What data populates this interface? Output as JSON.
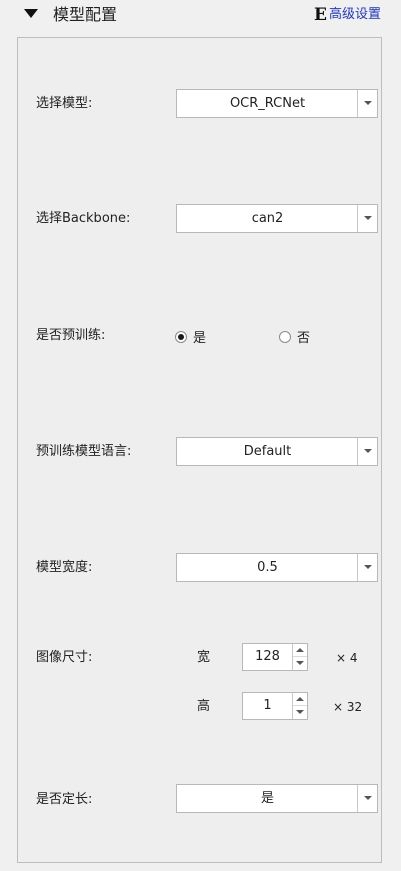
{
  "header": {
    "title": "模型配置",
    "advanced_icon": "E",
    "advanced_label": "高级设置"
  },
  "model": {
    "label": "选择模型:",
    "value": "OCR_RCNet"
  },
  "backbone": {
    "label": "选择Backbone:",
    "value": "can2"
  },
  "pretrained": {
    "label": "是否预训练:",
    "options": [
      {
        "label": "是",
        "selected": true
      },
      {
        "label": "否",
        "selected": false
      }
    ]
  },
  "pretrain_language": {
    "label": "预训练模型语言:",
    "value": "Default"
  },
  "model_width": {
    "label": "模型宽度:",
    "value": "0.5"
  },
  "image_size": {
    "label": "图像尺寸:",
    "width_label": "宽",
    "width_value": "128",
    "width_multiplier": "× 4",
    "height_label": "高",
    "height_value": "1",
    "height_multiplier": "× 32"
  },
  "fixed_length": {
    "label": "是否定长:",
    "value": "是"
  },
  "colors": {
    "accent_link": "#1f36c8",
    "background": "#f0f0f0",
    "border": "#bdbdbd"
  }
}
